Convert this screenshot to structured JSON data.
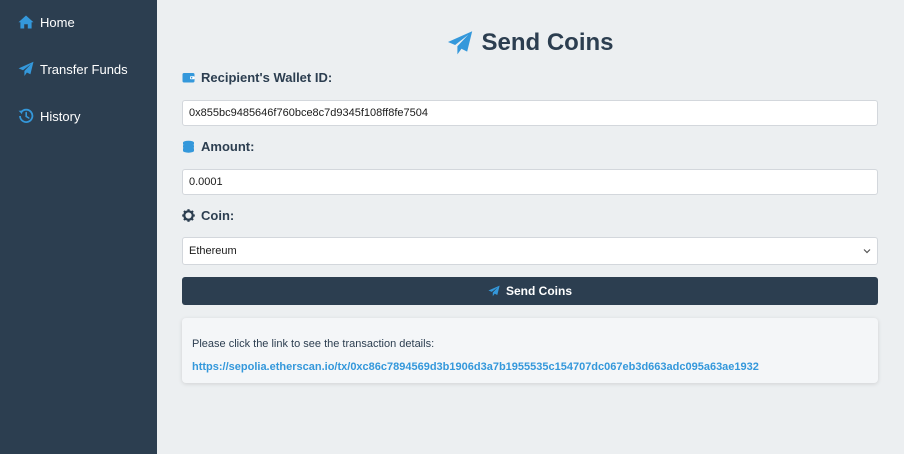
{
  "sidebar": {
    "items": [
      {
        "label": "Home",
        "icon": "home-icon"
      },
      {
        "label": "Transfer Funds",
        "icon": "paper-plane-icon"
      },
      {
        "label": "History",
        "icon": "history-icon"
      }
    ]
  },
  "main": {
    "title": "Send Coins",
    "title_icon": "paper-plane-icon",
    "recipient": {
      "label": "Recipient's Wallet ID:",
      "icon": "wallet-icon",
      "value": "0x855bc9485646f760bce8c7d9345f108ff8fe7504"
    },
    "amount": {
      "label": "Amount:",
      "icon": "coins-icon",
      "value": "0.0001"
    },
    "coin": {
      "label": "Coin:",
      "icon": "gear-icon",
      "selected": "Ethereum"
    },
    "send_button": {
      "label": "Send Coins",
      "icon": "paper-plane-icon"
    },
    "result": {
      "message": "Please click the link to see the transaction details:",
      "link": "https://sepolia.etherscan.io/tx/0xc86c7894569d3b1906d3a7b1955535c154707dc067eb3d663adc095a63ae1932"
    }
  },
  "colors": {
    "sidebar_bg": "#2c3e50",
    "page_bg": "#eceff1",
    "accent": "#3498db",
    "button_bg": "#2c3e50"
  }
}
